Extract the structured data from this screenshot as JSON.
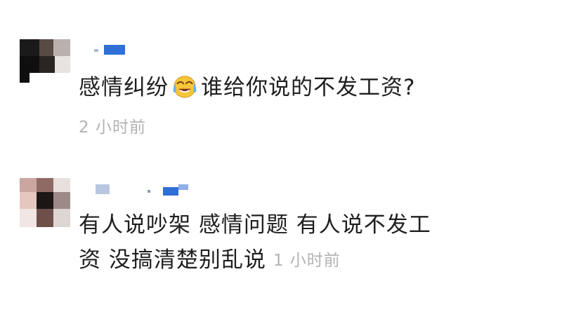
{
  "comments": [
    {
      "text_before_emoji": "感情纠纷",
      "emoji": "crying-laughing-emoji",
      "text_after_emoji": "谁给你说的不发工资?",
      "time": "2 小时前"
    },
    {
      "line1": "有人说吵架 感情问题 有人说不发工",
      "line2": "资 没搞清楚别乱说",
      "time": "1 小时前"
    }
  ],
  "colors": {
    "text": "#1f1f1f",
    "time": "#b3b3b3",
    "username_blur": "#2f6fd6"
  }
}
